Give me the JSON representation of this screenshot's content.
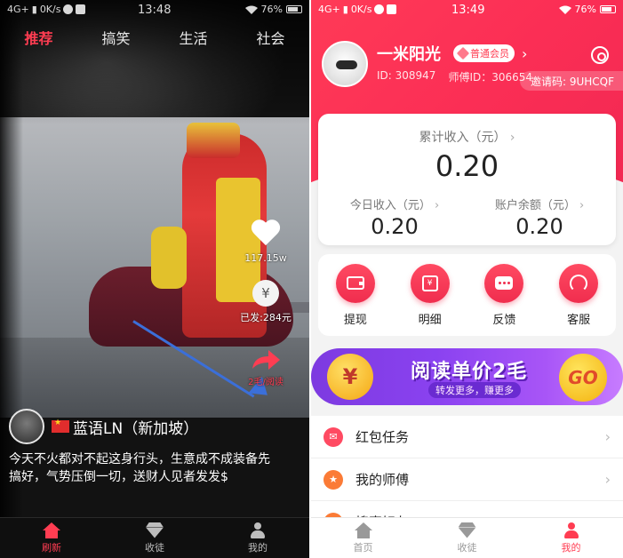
{
  "left": {
    "status": {
      "network": "4G+",
      "speed": "0K/s",
      "time": "13:48",
      "battery": "76%"
    },
    "tabs": [
      {
        "label": "推荐",
        "active": true
      },
      {
        "label": "搞笑",
        "active": false
      },
      {
        "label": "生活",
        "active": false
      },
      {
        "label": "社会",
        "active": false
      }
    ],
    "likes": "117.15w",
    "paid": "已发:284元",
    "share_reward": "2毛/阅读",
    "author_name": "蓝语LN（新加坡）",
    "caption": "今天不火都对不起这身行头，生意成不成装备先搞好，气势压倒一切，送财人见者发发$",
    "nav": [
      {
        "label": "刷新",
        "icon": "home-icon",
        "active": true
      },
      {
        "label": "收徒",
        "icon": "gem-icon",
        "active": false
      },
      {
        "label": "我的",
        "icon": "person-icon",
        "active": false
      }
    ]
  },
  "right": {
    "status": {
      "network": "4G+",
      "speed": "0K/s",
      "time": "13:49",
      "battery": "76%"
    },
    "profile": {
      "name": "一米阳光",
      "member": "普通会员",
      "id_text": "ID: 308947",
      "master_id_text": "师傅ID：306654",
      "invite": "邀请码: 9UHCQF"
    },
    "income": {
      "total_label": "累计收入（元）",
      "total_value": "0.20",
      "today_label": "今日收入（元）",
      "today_value": "0.20",
      "balance_label": "账户余额（元）",
      "balance_value": "0.20"
    },
    "actions": [
      {
        "label": "提现",
        "icon": "wallet-icon"
      },
      {
        "label": "明细",
        "icon": "calendar-icon"
      },
      {
        "label": "反馈",
        "icon": "chat-icon"
      },
      {
        "label": "客服",
        "icon": "headset-icon"
      }
    ],
    "banner": {
      "coin": "¥",
      "title": "阅读单价2毛",
      "subtitle": "转发更多，赚更多",
      "go": "GO"
    },
    "menu": [
      {
        "label": "红包任务",
        "icon": "redpacket-icon"
      },
      {
        "label": "我的师傅",
        "icon": "star-icon"
      },
      {
        "label": "搜索好友",
        "icon": "search-icon"
      }
    ],
    "nav": [
      {
        "label": "首页",
        "icon": "home-icon",
        "active": false
      },
      {
        "label": "收徒",
        "icon": "gem-icon",
        "active": false
      },
      {
        "label": "我的",
        "icon": "person-icon",
        "active": true
      }
    ]
  },
  "colors": {
    "accent": "#ff3d52",
    "hero": "#fb2e55",
    "banner": "#8a42f0",
    "link_blue": "#3b6fd9"
  }
}
